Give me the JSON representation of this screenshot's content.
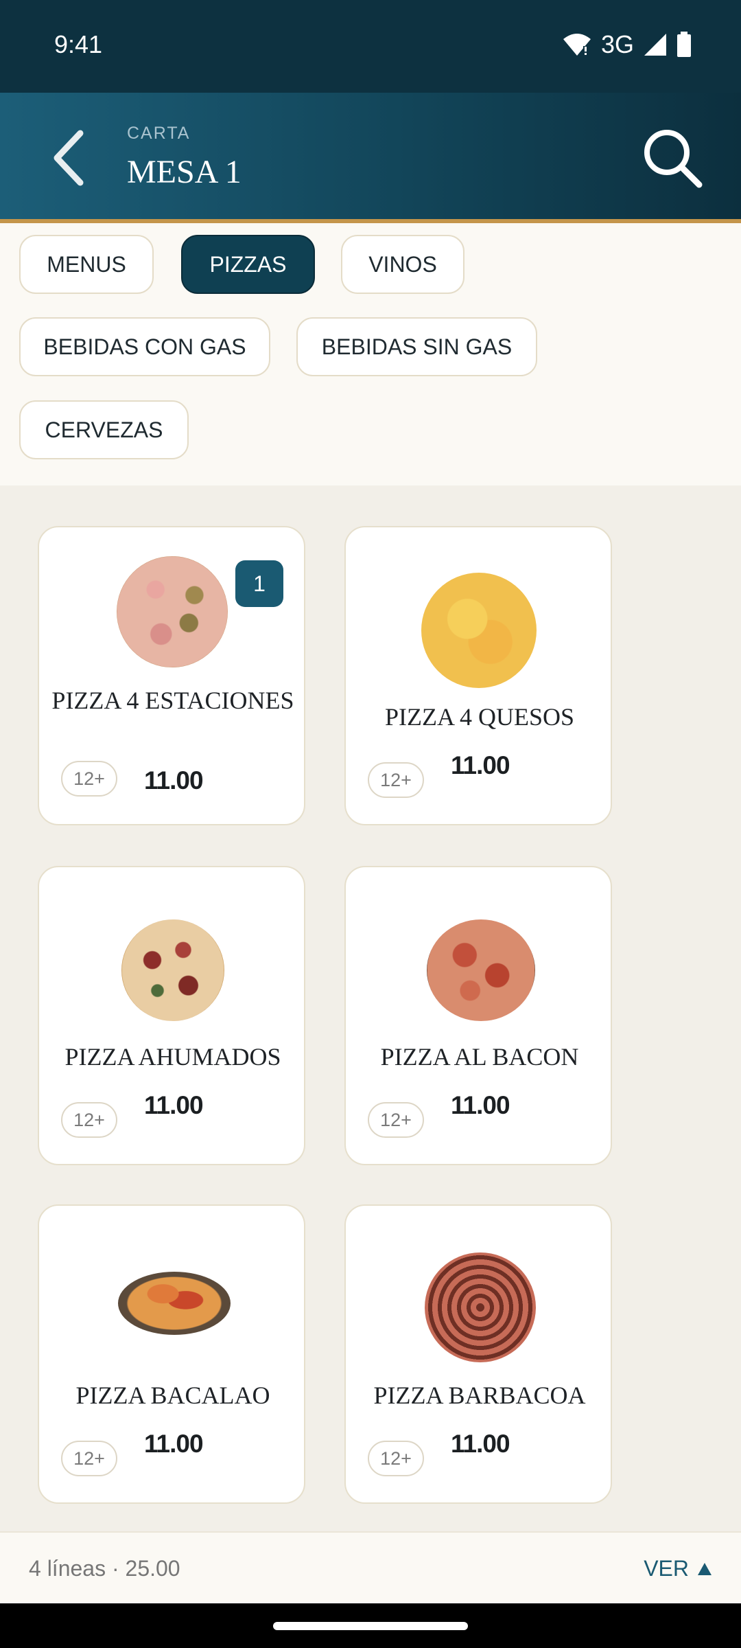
{
  "status_bar": {
    "time": "9:41",
    "network": "3G"
  },
  "header": {
    "subtitle": "CARTA",
    "title": "MESA 1"
  },
  "categories": [
    {
      "label": "MENUS"
    },
    {
      "label": "PIZZAS",
      "active": true
    },
    {
      "label": "VINOS"
    },
    {
      "label": "BEBIDAS CON GAS"
    },
    {
      "label": "BEBIDAS SIN GAS"
    },
    {
      "label": "CERVEZAS"
    }
  ],
  "products": [
    {
      "name": "PIZZA 4 ESTACIONES",
      "age": "12+",
      "price": "11.00",
      "qty": "1"
    },
    {
      "name": "PIZZA 4 QUESOS",
      "age": "12+",
      "price": "11.00"
    },
    {
      "name": "PIZZA AHUMADOS",
      "age": "12+",
      "price": "11.00"
    },
    {
      "name": "PIZZA AL BACON",
      "age": "12+",
      "price": "11.00"
    },
    {
      "name": "PIZZA BACALAO",
      "age": "12+",
      "price": "11.00"
    },
    {
      "name": "PIZZA BARBACOA",
      "age": "12+",
      "price": "11.00"
    }
  ],
  "order_bar": {
    "summary": "4 líneas · 25.00",
    "view_label": "VER"
  },
  "colors": {
    "header_dark": "#0d3140",
    "accent": "#1a5a72",
    "gold_rule": "#c4954a",
    "background": "#f2efe8"
  },
  "icons": {
    "back": "chevron-left-icon",
    "search": "search-icon",
    "wifi": "wifi-icon",
    "signal": "signal-icon",
    "battery": "battery-icon",
    "expand": "caret-up-icon"
  }
}
